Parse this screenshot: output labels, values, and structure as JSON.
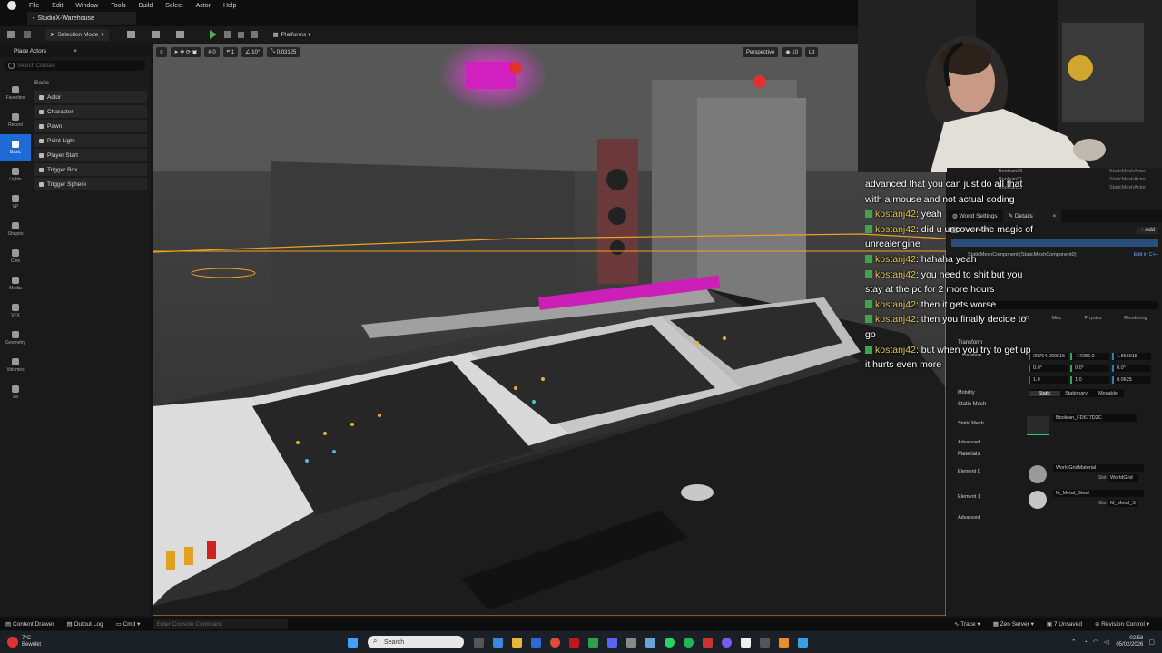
{
  "menu": {
    "items": [
      "File",
      "Edit",
      "Window",
      "Tools",
      "Build",
      "Select",
      "Actor",
      "Help"
    ]
  },
  "document_tab": {
    "label": "StudioX-Warehouse"
  },
  "toolbar": {
    "selection_mode": "Selection Mode",
    "platforms": "Platforms"
  },
  "place_actors": {
    "title": "Place Actors",
    "search_placeholder": "Search Classes",
    "categories": [
      {
        "label": "Favorites"
      },
      {
        "label": "Recent"
      },
      {
        "label": "Basic"
      },
      {
        "label": "Lights"
      },
      {
        "label": "VP"
      },
      {
        "label": "Shapes"
      },
      {
        "label": "Cine"
      },
      {
        "label": "Media"
      },
      {
        "label": "VFX"
      },
      {
        "label": "Geometry"
      },
      {
        "label": "Volumes"
      },
      {
        "label": "All"
      }
    ],
    "section": "Basic",
    "items": [
      "Actor",
      "Character",
      "Pawn",
      "Point Light",
      "Player Start",
      "Trigger Box",
      "Trigger Sphere"
    ]
  },
  "viewport": {
    "snap_angle": "10°",
    "snap_scale": "0.03125",
    "view_mode_perspective": "Perspective",
    "camera_speed": "10",
    "lit": "Lit",
    "grid_value": "1",
    "rot_value": "0"
  },
  "chat": {
    "lines": [
      {
        "name": "",
        "text": "advanced that you can just do all that with a mouse and not actual coding"
      },
      {
        "name": "kostanj42",
        "text": "yeah"
      },
      {
        "name": "kostanj42",
        "text": "did u uncover the magic of unrealengine"
      },
      {
        "name": "kostanj42",
        "text": "hahaha yeah"
      },
      {
        "name": "kostanj42",
        "text": "you need to shit but you stay at the pc for 2 more hours"
      },
      {
        "name": "kostanj42",
        "text": "then it gets worse"
      },
      {
        "name": "kostanj42",
        "text": "then you finally decide to go"
      },
      {
        "name": "kostanj42",
        "text": "but when you try to get up it hurts even more"
      }
    ]
  },
  "outliner": {
    "items": [
      "Boolean30",
      "Boolean31",
      "Boolean32"
    ],
    "type": "StaticMeshActor"
  },
  "details": {
    "tab_world": "World Settings",
    "tab_details": "Details",
    "actor_name": "Boolean28",
    "add_label": "Add",
    "component": "StaticMeshComponent (StaticMeshComponent0)",
    "edit_in_cpp": "Edit in C++",
    "filters": [
      "LOD",
      "Misc",
      "Physics",
      "Rendering"
    ],
    "transform": "Transform",
    "location_label": "Location",
    "location": [
      "20764.000015",
      "-17286.0",
      "1.866915"
    ],
    "rotation": [
      "0.0°",
      "0.0°",
      "0.0°"
    ],
    "scale": [
      "1.0",
      "1.0",
      "0.0625"
    ],
    "mobility_label": "Mobility",
    "mobility": [
      "Static",
      "Stationary",
      "Movable"
    ],
    "static_mesh_section": "Static Mesh",
    "static_mesh_label": "Static Mesh",
    "static_mesh_value": "Boolean_FD677D2C",
    "advanced": "Advanced",
    "materials_section": "Materials",
    "element0_label": "Element 0",
    "element0_value": "WorldGridMaterial",
    "element0_slot": "WorldGrid",
    "element1_label": "Element 1",
    "element1_value": "M_Metal_Steel",
    "element1_slot": "M_Metal_S",
    "slot_label": "Slot"
  },
  "statusbar": {
    "content_drawer": "Content Drawer",
    "output_log": "Output Log",
    "cmd": "Cmd",
    "console_placeholder": "Enter Console Command",
    "trace": "Trace",
    "zen_server": "Zen Server",
    "unsaved": "7 Unsaved",
    "revision_control": "Revision Control"
  },
  "taskbar": {
    "weather_temp": "7°C",
    "weather_desc": "Bewölkt",
    "search": "Search",
    "time": "02:58",
    "date": "05/02/2026"
  },
  "colors": {
    "accent": "#1e6ad6",
    "selection": "#f0a020",
    "chat_name": "#e6c84f",
    "magenta": "#e020d0"
  }
}
